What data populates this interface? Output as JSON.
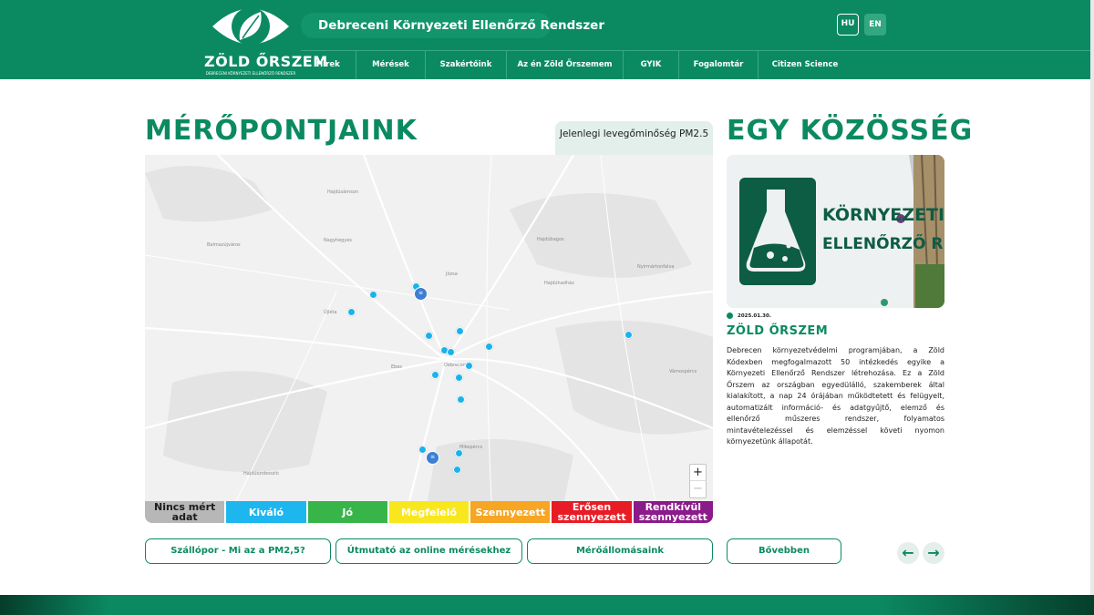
{
  "header": {
    "logo": {
      "name": "ZÖLD ŐRSZEM",
      "subtitle": "DEBRECENI KÖRNYEZETI ELLENŐRZŐ RENDSZER"
    },
    "site_title": "Debreceni Környezeti Ellenőrző Rendszer",
    "languages": [
      {
        "code": "HU",
        "active": true
      },
      {
        "code": "EN",
        "active": false
      }
    ],
    "nav": [
      "Hírek",
      "Mérések",
      "Szakértőink",
      "Az én Zöld Őrszemem",
      "GYIK",
      "Fogalomtár",
      "Citizen Science"
    ]
  },
  "measurement": {
    "heading": "MÉRŐPONTJAINK",
    "pm_label": "Jelenlegi levegőminőség PM2.5",
    "map": {
      "places": [
        "Hajdúsámson",
        "Balmazújváros",
        "Nagyhegyes",
        "Újléta",
        "Debrecen",
        "Hajdúhadház",
        "Ebes",
        "Vámospércs",
        "Hajdúszoboszló",
        "Mikepércs",
        "Hajdúbagos",
        "Nyírmártonfalva",
        "Józsa",
        "Hajdúbagos"
      ],
      "zoom_in": "+",
      "zoom_out": "−",
      "cluster_label": "≡"
    },
    "legend": [
      {
        "label": "Nincs mért\nadat",
        "color": "#b7b7b7"
      },
      {
        "label": "Kiváló",
        "color": "#1eb6ee"
      },
      {
        "label": "Jó",
        "color": "#38b549"
      },
      {
        "label": "Megfelelő",
        "color": "#f8e71c"
      },
      {
        "label": "Szennyezett",
        "color": "#f6a623"
      },
      {
        "label": "Erősen\nszennyezett",
        "color": "#e81c24"
      },
      {
        "label": "Rendkívül\nszennyezett",
        "color": "#8b1a8a"
      }
    ],
    "buttons": {
      "pm_info": "Szállópor - Mi az a PM2,5?",
      "guide": "Útmutató az online mérésekhez",
      "stations": "Mérőállomásaink"
    }
  },
  "community": {
    "heading": "EGY KÖZÖSSÉG",
    "photo_text": [
      "KÖRNYEZETI",
      "ELLENŐRZŐ RENDSZ"
    ],
    "news": {
      "date": "2025.01.30.",
      "title": "ZÖLD ŐRSZEM",
      "body": "Debrecen környezetvédelmi programjában, a Zöld Kódexben megfogalmazott 50 intézkedés egyike a Környezeti Ellenőrző Rendszer létrehozása. Ez a Zöld Őrszem az országban egyedülálló, szakemberek által kialakított, a nap 24 órájában működtetett és felügyelt, automatizált információ- és adatgyűjtő, elemző és ellenőrző műszeres rendszer, folyamatos mintavételezéssel és elemzéssel követi nyomon környezetünk állapotát."
    },
    "more_button": "Bővebben",
    "prev_arrow": "←",
    "next_arrow": "→"
  },
  "colors": {
    "brand_green": "#0b8a62",
    "marker_blue": "#19b3ec"
  }
}
